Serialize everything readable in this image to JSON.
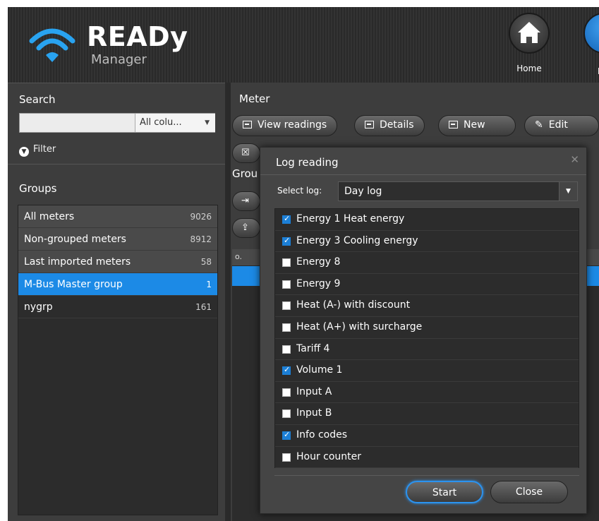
{
  "app": {
    "title": "READy",
    "subtitle": "Manager",
    "nav": [
      {
        "label": "Home"
      },
      {
        "label": "M"
      }
    ]
  },
  "search": {
    "title": "Search",
    "value": "",
    "column_select": "All colu...",
    "filter_label": "Filter"
  },
  "groups": {
    "title": "Groups",
    "items": [
      {
        "name": "All meters",
        "count": "9026"
      },
      {
        "name": "Non-grouped meters",
        "count": "8912"
      },
      {
        "name": "Last imported meters",
        "count": "58"
      },
      {
        "name": "M-Bus Master group",
        "count": "1",
        "selected": true
      },
      {
        "name": "nygrp",
        "count": "161"
      }
    ]
  },
  "meter": {
    "title": "Meter",
    "buttons": {
      "view_readings": "View readings",
      "details": "Details",
      "new": "New",
      "edit": "Edit"
    },
    "group_title": "Grou",
    "table_header": "o."
  },
  "dialog": {
    "title": "Log reading",
    "close_glyph": "✕",
    "select_label": "Select log:",
    "select_value": "Day log",
    "items": [
      {
        "label": "Energy 1 Heat energy",
        "checked": true
      },
      {
        "label": "Energy 3 Cooling energy",
        "checked": true
      },
      {
        "label": "Energy 8",
        "checked": false
      },
      {
        "label": "Energy 9",
        "checked": false
      },
      {
        "label": "Heat (A-) with discount",
        "checked": false
      },
      {
        "label": "Heat (A+) with surcharge",
        "checked": false
      },
      {
        "label": "Tariff 4",
        "checked": false
      },
      {
        "label": "Volume 1",
        "checked": true
      },
      {
        "label": "Input A",
        "checked": false
      },
      {
        "label": "Input B",
        "checked": false
      },
      {
        "label": "Info codes",
        "checked": true
      },
      {
        "label": "Hour counter",
        "checked": false
      }
    ],
    "start_label": "Start",
    "close_label": "Close"
  },
  "colors": {
    "accent": "#1c8ae6",
    "panel": "#3d3d3d",
    "list_bg": "#2c2c2c"
  }
}
